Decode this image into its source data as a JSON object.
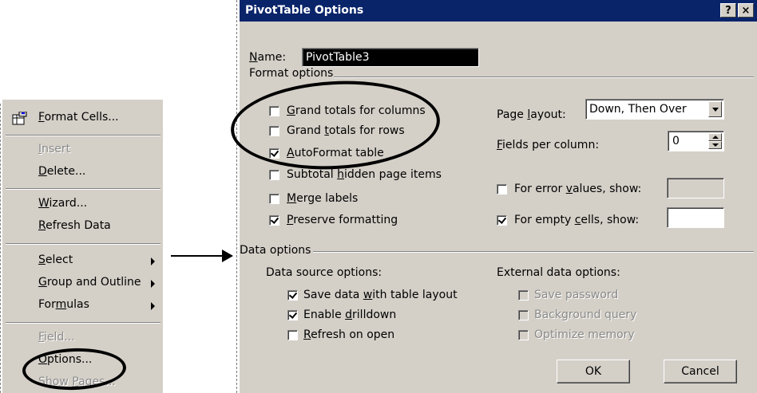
{
  "menu": {
    "items": [
      {
        "label": "Format Cells...",
        "u": "F",
        "disabled": false,
        "submenu": false
      },
      {
        "label": "Insert",
        "u": "I",
        "disabled": true,
        "submenu": false
      },
      {
        "label": "Delete...",
        "u": "D",
        "disabled": false,
        "submenu": false
      },
      {
        "label": "Wizard...",
        "u": "W",
        "disabled": false,
        "submenu": false
      },
      {
        "label": "Refresh Data",
        "u": "R",
        "disabled": false,
        "submenu": false
      },
      {
        "label": "Select",
        "u": "S",
        "disabled": false,
        "submenu": true
      },
      {
        "label": "Group and Outline",
        "u": "G",
        "disabled": false,
        "submenu": true
      },
      {
        "label": "Formulas",
        "u": "m",
        "disabled": false,
        "submenu": true
      },
      {
        "label": "Field...",
        "u": "F",
        "disabled": true,
        "submenu": false
      },
      {
        "label": "Options...",
        "u": "O",
        "disabled": false,
        "submenu": false
      },
      {
        "label": "Show Pages...",
        "u": "P",
        "disabled": true,
        "submenu": false
      }
    ]
  },
  "dialog": {
    "title": "PivotTable Options",
    "help_btn": "?",
    "close_btn": "×",
    "name_label": "Name:",
    "name_value": "PivotTable3",
    "format_options_label": "Format options",
    "format_left": [
      {
        "label": "Grand totals for columns",
        "checked": false
      },
      {
        "label": "Grand totals for rows",
        "checked": false
      },
      {
        "label": "AutoFormat table",
        "checked": true
      },
      {
        "label": "Subtotal hidden page items",
        "checked": false
      },
      {
        "label": "Merge labels",
        "checked": false
      },
      {
        "label": "Preserve formatting",
        "checked": true
      }
    ],
    "page_layout_label": "Page layout:",
    "page_layout_value": "Down, Then Over",
    "fields_per_column_label": "Fields per column:",
    "fields_per_column_value": "0",
    "error_values_label": "For error values, show:",
    "error_values_checked": false,
    "empty_cells_label": "For empty cells, show:",
    "empty_cells_checked": true,
    "data_options_label": "Data options",
    "data_source_label": "Data source options:",
    "data_source": [
      {
        "label": "Save data with table layout",
        "checked": true
      },
      {
        "label": "Enable drilldown",
        "checked": true
      },
      {
        "label": "Refresh on open",
        "checked": false
      }
    ],
    "external_label": "External data options:",
    "external": [
      {
        "label": "Save password",
        "checked": false
      },
      {
        "label": "Background query",
        "checked": false
      },
      {
        "label": "Optimize memory",
        "checked": false
      }
    ],
    "ok_label": "OK",
    "cancel_label": "Cancel"
  }
}
